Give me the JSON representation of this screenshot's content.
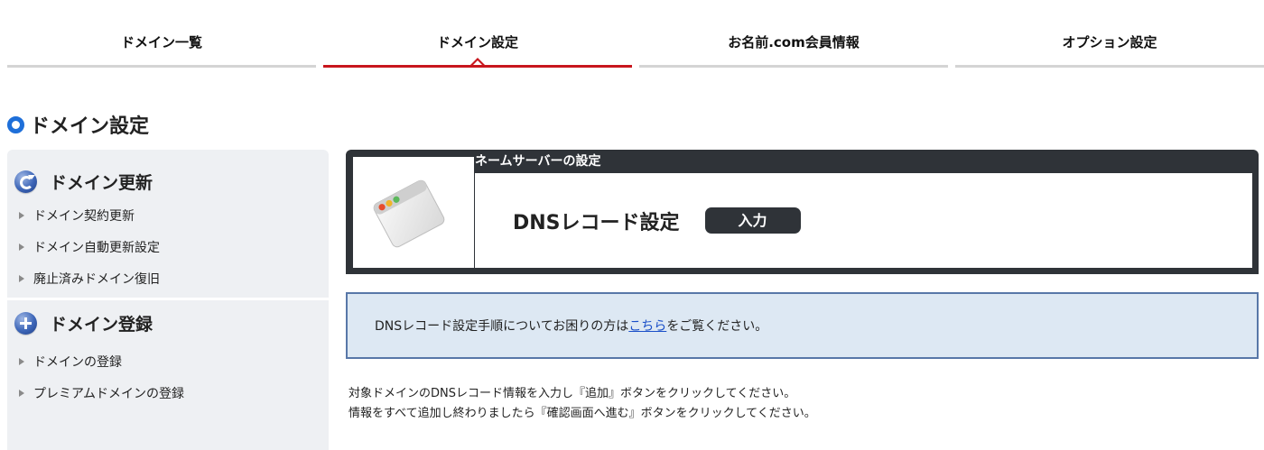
{
  "tabs": [
    {
      "label": "ドメイン一覧",
      "active": false
    },
    {
      "label": "ドメイン設定",
      "active": true
    },
    {
      "label": "お名前.com会員情報",
      "active": false
    },
    {
      "label": "オプション設定",
      "active": false
    }
  ],
  "page": {
    "title": "ドメイン設定"
  },
  "sidebar": {
    "sections": [
      {
        "title": "ドメイン更新",
        "icon": "refresh-icon",
        "links": [
          "ドメイン契約更新",
          "ドメイン自動更新設定",
          "廃止済みドメイン復旧"
        ]
      },
      {
        "title": "ドメイン登録",
        "icon": "plus-icon",
        "links": [
          "ドメインの登録",
          "プレミアムドメインの登録"
        ]
      }
    ]
  },
  "server_box": {
    "header": "ネームサーバーの設定",
    "dns_label": "DNSレコード設定",
    "input_button": "入力"
  },
  "info": {
    "before_link": "DNSレコード設定手順についてお困りの方は",
    "link": "こちら",
    "after_link": "をご覧ください。"
  },
  "instructions": {
    "line1": "対象ドメインのDNSレコード情報を入力し『追加』ボタンをクリックしてください。",
    "line2": "情報をすべて追加し終わりましたら『確認画面へ進む』ボタンをクリックしてください。"
  },
  "colors": {
    "accent_red": "#c8161d",
    "brand_blue": "#1e6fd9",
    "dark_panel": "#2f3338",
    "info_bg": "#dde8f3",
    "info_border": "#5877a8",
    "link": "#1a4fc8"
  }
}
